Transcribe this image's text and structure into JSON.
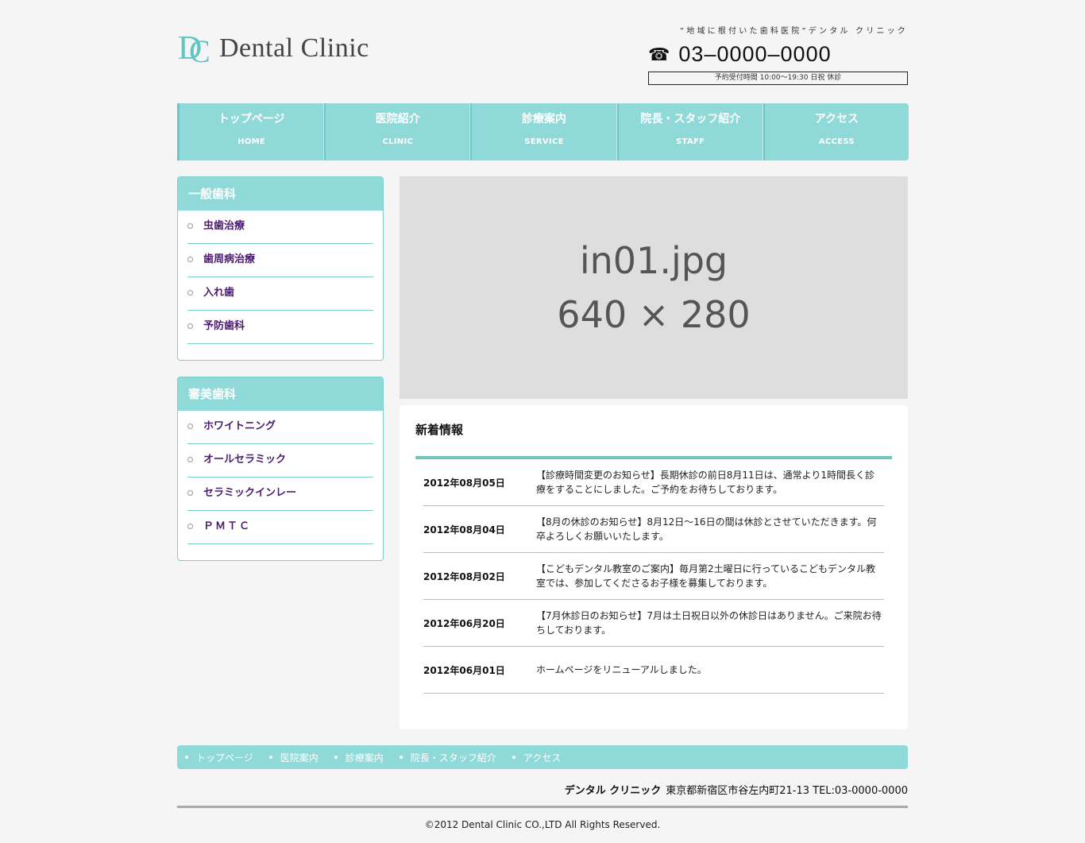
{
  "header": {
    "logo_text": "Dental Clinic",
    "tagline": "”地域に根付いた歯科医院”デンタル クリニック",
    "phone": "03–0000–0000",
    "hours": "予約受付時間 10:00〜19:30 日祝 休診"
  },
  "nav": [
    {
      "jp": "トップページ",
      "en": "HOME"
    },
    {
      "jp": "医院紹介",
      "en": "CLINIC"
    },
    {
      "jp": "診療案内",
      "en": "SERVICE"
    },
    {
      "jp": "院長・スタッフ紹介",
      "en": "STAFF"
    },
    {
      "jp": "アクセス",
      "en": "ACCESS"
    }
  ],
  "sidebar": {
    "general": {
      "title": "一般歯科",
      "items": [
        "虫歯治療",
        "歯周病治療",
        "入れ歯",
        "予防歯科"
      ]
    },
    "cosmetic": {
      "title": "審美歯科",
      "items": [
        "ホワイトニング",
        "オールセラミック",
        "セラミックインレー",
        "ＰＭＴＣ"
      ]
    }
  },
  "hero": {
    "line1": "in01.jpg",
    "line2": "640 × 280"
  },
  "news": {
    "title": "新着情報",
    "items": [
      {
        "date": "2012年08月05日",
        "text": "【診療時間変更のお知らせ】長期休診の前日8月11日は、通常より1時間長く診療をすることにしました。ご予約をお待ちしております。"
      },
      {
        "date": "2012年08月04日",
        "text": "【8月の休診のお知らせ】8月12日〜16日の間は休診とさせていただきます。何卒よろしくお願いいたします。"
      },
      {
        "date": "2012年08月02日",
        "text": "【こどもデンタル教室のご案内】毎月第2土曜日に行っているこどもデンタル教室では、参加してくださるお子様を募集しております。"
      },
      {
        "date": "2012年06月20日",
        "text": "【7月休診日のお知らせ】7月は土日祝日以外の休診日はありません。ご来院お待ちしております。"
      },
      {
        "date": "2012年06月01日",
        "text": "ホームページをリニューアルしました。"
      }
    ]
  },
  "footer": {
    "nav": [
      "トップページ",
      "医院案内",
      "診療案内",
      "院長・スタッフ紹介",
      "アクセス"
    ],
    "clinic_name": "デンタル クリニック",
    "address": "東京都新宿区市谷左内町21-13 TEL:03-0000-0000",
    "copyright": "©2012 Dental Clinic CO.,LTD All Rights Reserved."
  },
  "colors": {
    "accent": "#8fdad9",
    "accent_dark": "#6ec6c4",
    "link": "#4b1d6e",
    "background": "#f5f5f5"
  }
}
